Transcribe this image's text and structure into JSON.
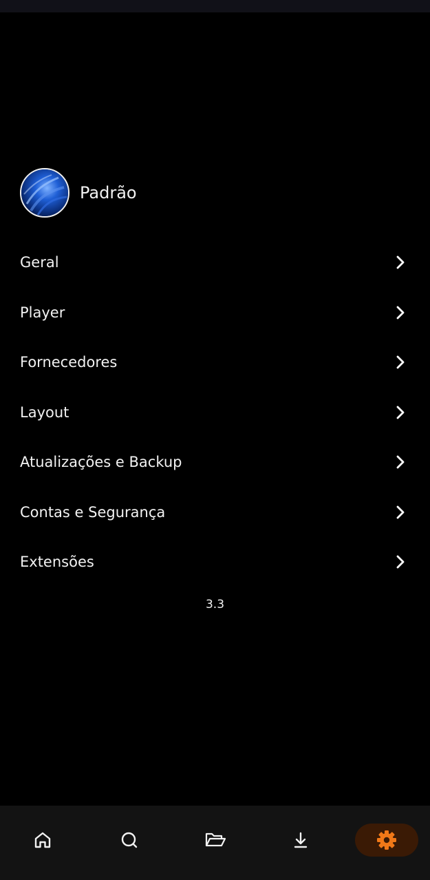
{
  "profile": {
    "name": "Padrão"
  },
  "menu": {
    "items": [
      {
        "label": "Geral"
      },
      {
        "label": "Player"
      },
      {
        "label": "Fornecedores"
      },
      {
        "label": "Layout"
      },
      {
        "label": "Atualizações e Backup"
      },
      {
        "label": "Contas e Segurança"
      },
      {
        "label": "Extensões"
      }
    ]
  },
  "version": "3.3",
  "bottom_nav": {
    "items": [
      {
        "icon": "home-icon"
      },
      {
        "icon": "search-icon"
      },
      {
        "icon": "folder-open-icon"
      },
      {
        "icon": "download-icon"
      },
      {
        "icon": "gear-icon",
        "active": true
      }
    ],
    "accent_color": "#f07818",
    "active_bg_color": "#3a1a05"
  }
}
